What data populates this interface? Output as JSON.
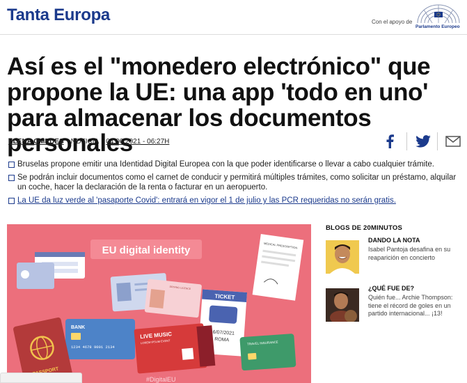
{
  "header": {
    "brand": "Tanta Europa",
    "support_text": "Con el apoyo de",
    "parliament_label": "Parlamento Europeo"
  },
  "article": {
    "headline": "Así es el \"monedero electrónico\" que propone la UE: una app 'todo en uno' para almacenar los documentos personales",
    "author": "ELENA OMEDES",
    "type": "NOTICIA",
    "date": "04.06.2021 - 06:27H",
    "bullets": [
      "Bruselas propone emitir una Identidad Digital Europea con la que poder identificarse o llevar a cabo cualquier trámite.",
      "Se podrán incluir documentos como el carnet de conducir y permitirá múltiples trámites, como solicitar un préstamo, alquilar un coche, hacer la declaración de la renta o facturar en un aeropuerto.",
      "La UE da luz verde al 'pasaporte Covid': entrará en vigor el 1 de julio y las PCR requeridas no serán gratis."
    ]
  },
  "hero_image": {
    "banner": "EU digital identity",
    "ticket_label": "TICKET",
    "ticket_date": "16/07/2021",
    "ticket_city": "ROMA",
    "bank_label": "BANK",
    "bank_number": "1234 4678 9001 2134",
    "music_label": "LIVE MUSIC",
    "music_sub": "LOREM IPSUM EVENT",
    "passport_label": "PASSPORT",
    "licence_label": "DRIVING LICENCE",
    "insurance_label": "TRAVEL INSURANCE",
    "prescription_label": "MEDICAL PRESCRIPTION",
    "hashtag": "#DigitalEU",
    "accent_color": "#ec6f7c"
  },
  "sidebar": {
    "title": "BLOGS DE 20MINUTOS",
    "items": [
      {
        "section": "DANDO LA NOTA",
        "text": "Isabel Pantoja desafina en su reaparición en concierto"
      },
      {
        "section": "¿QUÉ FUE DE?",
        "text": "Quién fue... Archie Thompson: tiene el récord de goles en un partido internacional... ¡13!"
      }
    ]
  }
}
